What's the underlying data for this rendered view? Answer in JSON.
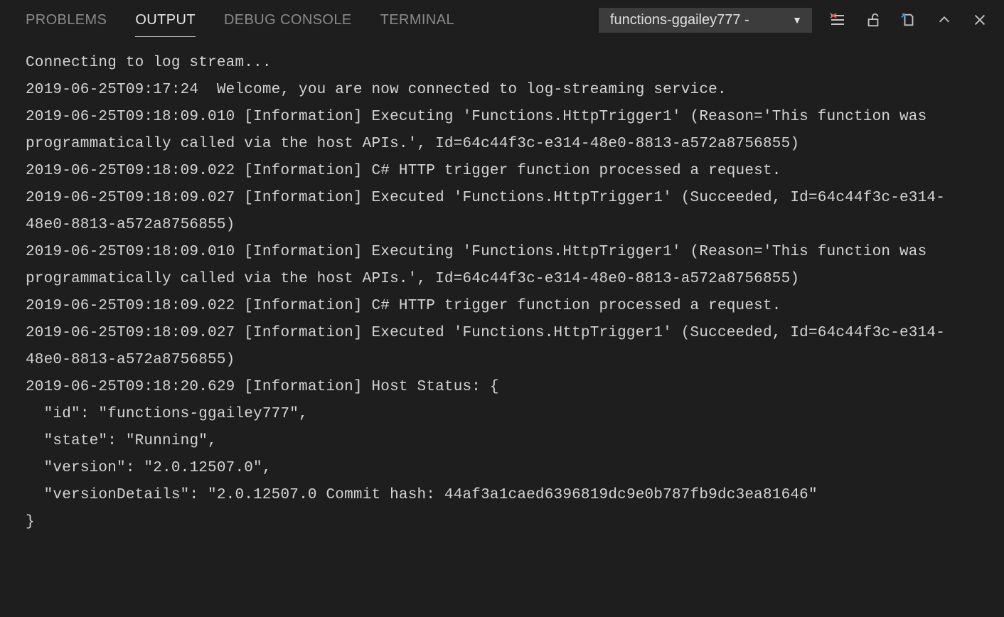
{
  "tabs": {
    "problems": "PROBLEMS",
    "output": "OUTPUT",
    "debug_console": "DEBUG CONSOLE",
    "terminal": "TERMINAL"
  },
  "dropdown": {
    "selected": "functions-ggailey777 -"
  },
  "icons": {
    "clear": "clear-output-icon",
    "lock": "lock-scroll-icon",
    "open": "open-log-icon",
    "collapse": "collapse-icon",
    "close": "close-panel-icon"
  },
  "log_lines": [
    "Connecting to log stream...",
    "2019-06-25T09:17:24  Welcome, you are now connected to log-streaming service.",
    "2019-06-25T09:18:09.010 [Information] Executing 'Functions.HttpTrigger1' (Reason='This function was programmatically called via the host APIs.', Id=64c44f3c-e314-48e0-8813-a572a8756855)",
    "2019-06-25T09:18:09.022 [Information] C# HTTP trigger function processed a request.",
    "2019-06-25T09:18:09.027 [Information] Executed 'Functions.HttpTrigger1' (Succeeded, Id=64c44f3c-e314-48e0-8813-a572a8756855)",
    "2019-06-25T09:18:09.010 [Information] Executing 'Functions.HttpTrigger1' (Reason='This function was programmatically called via the host APIs.', Id=64c44f3c-e314-48e0-8813-a572a8756855)",
    "2019-06-25T09:18:09.022 [Information] C# HTTP trigger function processed a request.",
    "2019-06-25T09:18:09.027 [Information] Executed 'Functions.HttpTrigger1' (Succeeded, Id=64c44f3c-e314-48e0-8813-a572a8756855)",
    "2019-06-25T09:18:20.629 [Information] Host Status: {",
    "  \"id\": \"functions-ggailey777\",",
    "  \"state\": \"Running\",",
    "  \"version\": \"2.0.12507.0\",",
    "  \"versionDetails\": \"2.0.12507.0 Commit hash: 44af3a1caed6396819dc9e0b787fb9dc3ea81646\"",
    "}"
  ]
}
